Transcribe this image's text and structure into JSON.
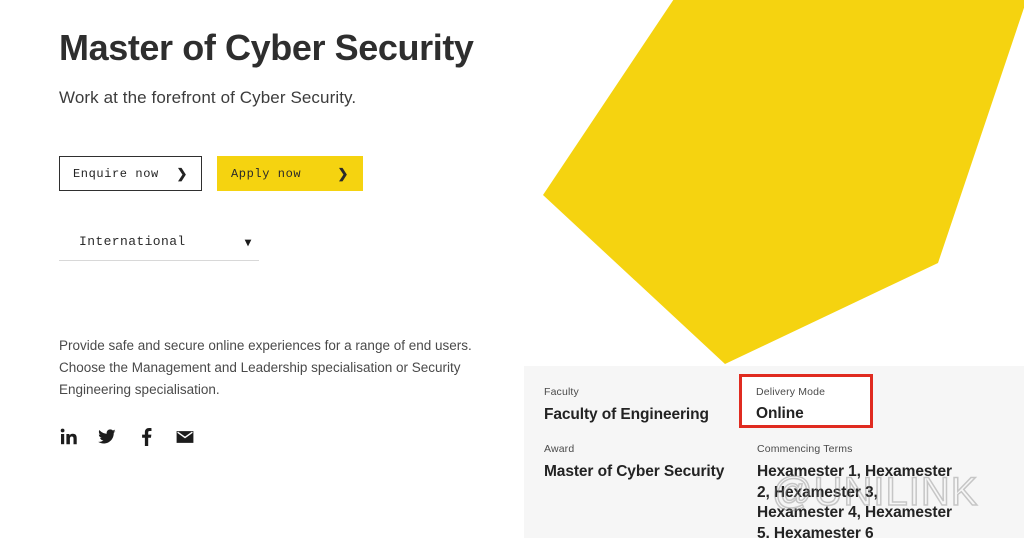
{
  "hero": {
    "title": "Master of Cyber Security",
    "subtitle": "Work at the forefront of Cyber Security.",
    "shape_color": "#f5d310"
  },
  "cta": {
    "enquire_label": "Enquire now",
    "enquire_chevron": "chevron-right-icon",
    "apply_label": "Apply now",
    "apply_chevron": "chevron-right-icon",
    "apply_bg": "#f5d310"
  },
  "audience_select": {
    "value": "International",
    "caret": "chevron-down-icon"
  },
  "description": "Provide safe and secure online experiences for a range of end users. Choose the Management and Leadership specialisation or Security Engineering specialisation.",
  "social": [
    {
      "name": "linkedin-icon",
      "label": "in"
    },
    {
      "name": "twitter-icon",
      "label": "Twitter"
    },
    {
      "name": "facebook-icon",
      "label": "f"
    },
    {
      "name": "email-icon",
      "label": "Email"
    }
  ],
  "info_panel": {
    "background": "#f6f6f6",
    "left_column": [
      {
        "label": "Faculty",
        "value": "Faculty of Engineering"
      },
      {
        "label": "Award",
        "value": "Master of Cyber Security"
      }
    ],
    "right_column": [
      {
        "label": "Delivery Mode",
        "value": "Online"
      },
      {
        "label": "Commencing Terms",
        "value": "Hexamester 1, Hexamester 2, Hexamester 3, Hexamester 4, Hexamester 5, Hexamester 6"
      }
    ]
  },
  "annotation": {
    "color": "#e02b20",
    "label": "Delivery Mode",
    "value": "Online"
  },
  "watermark": {
    "text": "@UNILINK"
  }
}
